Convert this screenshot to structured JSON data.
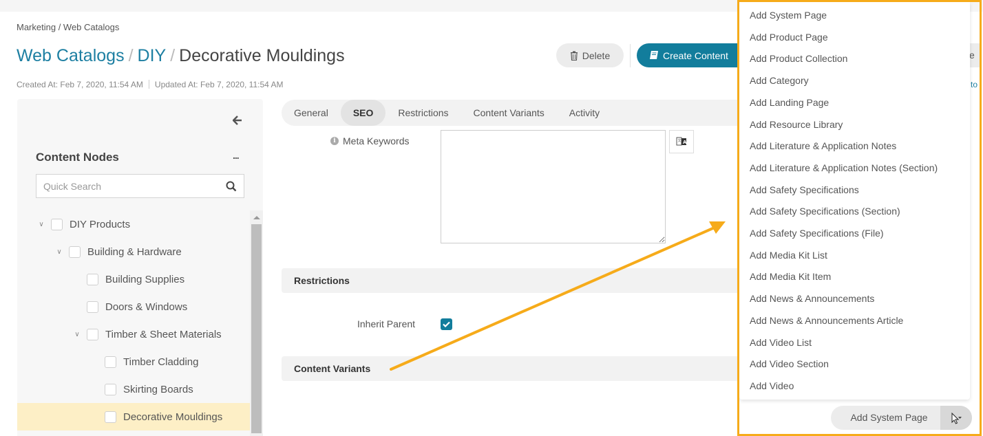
{
  "breadcrumb": "Marketing / Web Catalogs",
  "title": {
    "parts": [
      "Web Catalogs",
      "DIY",
      "Decorative Mouldings"
    ],
    "separator": "/"
  },
  "meta": {
    "created": "Created At: Feb 7, 2020, 11:54 AM",
    "updated": "Updated At: Feb 7, 2020, 11:54 AM"
  },
  "actions": {
    "delete_label": "Delete",
    "create_content_label": "Create Content",
    "partial_button_text": "e",
    "partial_link_text": "to"
  },
  "sidebar": {
    "title": "Content Nodes",
    "more_label": "...",
    "search_placeholder": "Quick Search",
    "tree": [
      {
        "label": "DIY Products",
        "level": 0,
        "expanded": true,
        "selected": false
      },
      {
        "label": "Building & Hardware",
        "level": 1,
        "expanded": true,
        "selected": false
      },
      {
        "label": "Building Supplies",
        "level": 2,
        "expanded": null,
        "selected": false
      },
      {
        "label": "Doors & Windows",
        "level": 2,
        "expanded": null,
        "selected": false
      },
      {
        "label": "Timber & Sheet Materials",
        "level": 2,
        "expanded": true,
        "selected": false
      },
      {
        "label": "Timber Cladding",
        "level": 3,
        "expanded": null,
        "selected": false
      },
      {
        "label": "Skirting Boards",
        "level": 3,
        "expanded": null,
        "selected": false
      },
      {
        "label": "Decorative Mouldings",
        "level": 3,
        "expanded": null,
        "selected": true
      }
    ]
  },
  "tabs": [
    {
      "label": "General",
      "active": false
    },
    {
      "label": "SEO",
      "active": true
    },
    {
      "label": "Restrictions",
      "active": false
    },
    {
      "label": "Content Variants",
      "active": false
    },
    {
      "label": "Activity",
      "active": false
    }
  ],
  "form": {
    "meta_keywords_label": "Meta Keywords",
    "meta_keywords_value": "",
    "restrictions_section": "Restrictions",
    "inherit_parent_label": "Inherit Parent",
    "inherit_parent_checked": true,
    "content_variants_section": "Content Variants"
  },
  "dropdown": {
    "items": [
      "Add System Page",
      "Add Product Page",
      "Add Product Collection",
      "Add Category",
      "Add Landing Page",
      "Add Resource Library",
      "Add Literature & Application Notes",
      "Add Literature & Application Notes (Section)",
      "Add Safety Specifications",
      "Add Safety Specifications (Section)",
      "Add Safety Specifications (File)",
      "Add Media Kit List",
      "Add Media Kit Item",
      "Add News & Announcements",
      "Add News & Announcements Article",
      "Add Video List",
      "Add Video Section",
      "Add Video"
    ],
    "split_button_label": "Add System Page"
  },
  "colors": {
    "accent": "#127d9c",
    "link": "#1d7fa2",
    "highlight_frame": "#f6ab1a",
    "selected_row": "#fdefc6"
  }
}
